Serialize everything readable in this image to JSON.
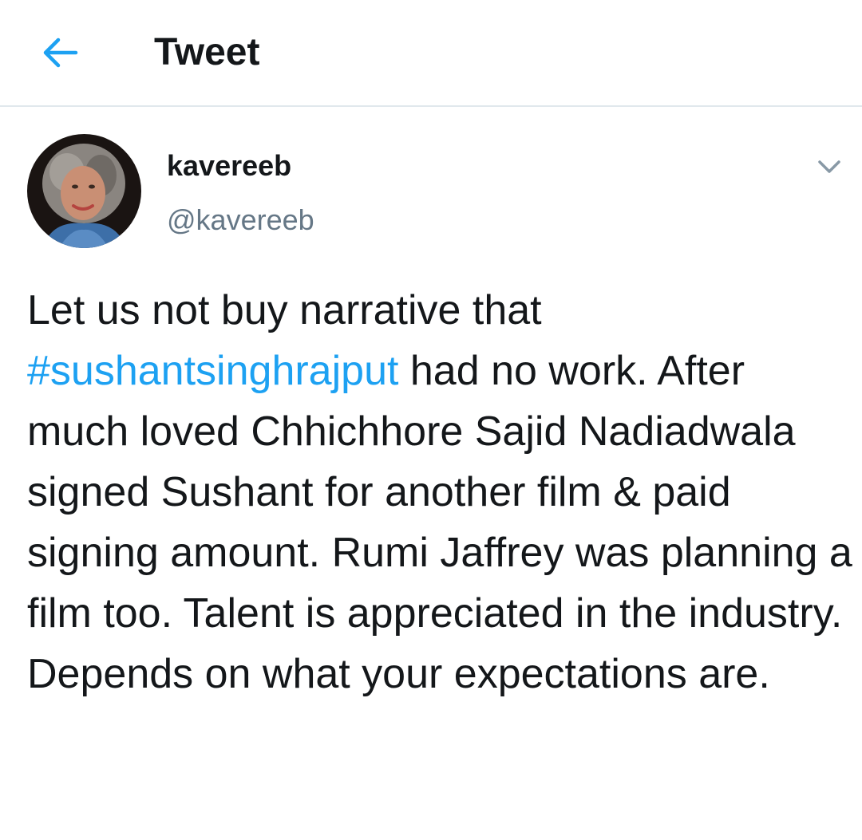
{
  "header": {
    "title": "Tweet",
    "back_icon": "arrow-left-icon"
  },
  "tweet": {
    "author": {
      "display_name": "kavereeb",
      "handle": "@kavereeb",
      "avatar": "profile-photo"
    },
    "menu_icon": "chevron-down-icon",
    "text": {
      "before": "Let us not buy narrative that ",
      "hashtag": "#sushantsinghrajput",
      "after": " had no work. After much loved Chhichhore Sajid Nadiadwala signed Sushant for another film & paid signing amount. Rumi Jaffrey was planning a film too. Talent is appreciated in the industry. Depends on what your expectations are."
    }
  },
  "colors": {
    "accent": "#1da1f2",
    "text": "#14171a",
    "secondary": "#657786",
    "divider": "#e1e8ed"
  }
}
